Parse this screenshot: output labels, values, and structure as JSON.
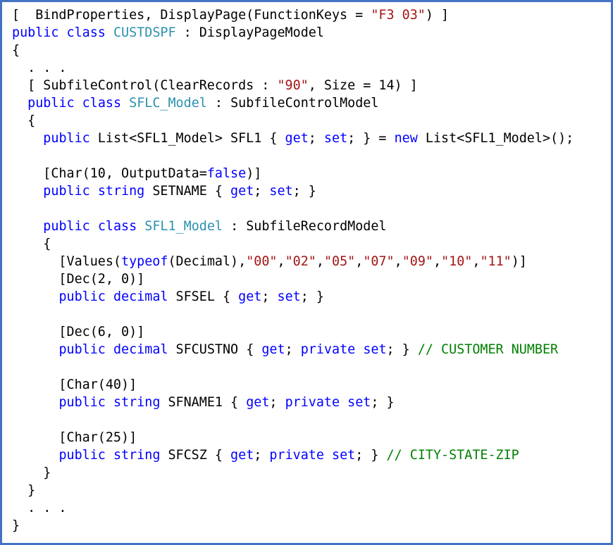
{
  "document": {
    "kind": "code-listing",
    "language": "C#",
    "colors": {
      "keyword": "#0000FF",
      "type_name": "#2B91AF",
      "string": "#A31515",
      "comment": "#008000",
      "plain": "#000000",
      "border": "#4472C4"
    },
    "lines": [
      [
        {
          "t": "pl",
          "v": "[  BindProperties, DisplayPage(FunctionKeys = "
        },
        {
          "t": "str",
          "v": "\"F3 03\""
        },
        {
          "t": "pl",
          "v": ") ]"
        }
      ],
      [
        {
          "t": "kw",
          "v": "public"
        },
        {
          "t": "pl",
          "v": " "
        },
        {
          "t": "kw",
          "v": "class"
        },
        {
          "t": "pl",
          "v": " "
        },
        {
          "t": "ty",
          "v": "CUSTDSPF"
        },
        {
          "t": "pl",
          "v": " : DisplayPageModel"
        }
      ],
      [
        {
          "t": "pl",
          "v": "{"
        }
      ],
      [
        {
          "t": "pl",
          "v": "  . . ."
        }
      ],
      [
        {
          "t": "pl",
          "v": "  [ SubfileControl(ClearRecords : "
        },
        {
          "t": "str",
          "v": "\"90\""
        },
        {
          "t": "pl",
          "v": ", Size = 14) ]"
        }
      ],
      [
        {
          "t": "pl",
          "v": "  "
        },
        {
          "t": "kw",
          "v": "public"
        },
        {
          "t": "pl",
          "v": " "
        },
        {
          "t": "kw",
          "v": "class"
        },
        {
          "t": "pl",
          "v": " "
        },
        {
          "t": "ty",
          "v": "SFLC_Model"
        },
        {
          "t": "pl",
          "v": " : SubfileControlModel"
        }
      ],
      [
        {
          "t": "pl",
          "v": "  {"
        }
      ],
      [
        {
          "t": "pl",
          "v": "    "
        },
        {
          "t": "kw",
          "v": "public"
        },
        {
          "t": "pl",
          "v": " List<SFL1_Model> SFL1 { "
        },
        {
          "t": "kw",
          "v": "get"
        },
        {
          "t": "pl",
          "v": "; "
        },
        {
          "t": "kw",
          "v": "set"
        },
        {
          "t": "pl",
          "v": "; } = "
        },
        {
          "t": "kw",
          "v": "new"
        },
        {
          "t": "pl",
          "v": " List<SFL1_Model>();"
        }
      ],
      [
        {
          "t": "pl",
          "v": ""
        }
      ],
      [
        {
          "t": "pl",
          "v": "    [Char(10, OutputData="
        },
        {
          "t": "kw",
          "v": "false"
        },
        {
          "t": "pl",
          "v": ")]"
        }
      ],
      [
        {
          "t": "pl",
          "v": "    "
        },
        {
          "t": "kw",
          "v": "public"
        },
        {
          "t": "pl",
          "v": " "
        },
        {
          "t": "kw",
          "v": "string"
        },
        {
          "t": "pl",
          "v": " SETNAME { "
        },
        {
          "t": "kw",
          "v": "get"
        },
        {
          "t": "pl",
          "v": "; "
        },
        {
          "t": "kw",
          "v": "set"
        },
        {
          "t": "pl",
          "v": "; }"
        }
      ],
      [
        {
          "t": "pl",
          "v": ""
        }
      ],
      [
        {
          "t": "pl",
          "v": "    "
        },
        {
          "t": "kw",
          "v": "public"
        },
        {
          "t": "pl",
          "v": " "
        },
        {
          "t": "kw",
          "v": "class"
        },
        {
          "t": "pl",
          "v": " "
        },
        {
          "t": "ty",
          "v": "SFL1_Model"
        },
        {
          "t": "pl",
          "v": " : SubfileRecordModel"
        }
      ],
      [
        {
          "t": "pl",
          "v": "    {"
        }
      ],
      [
        {
          "t": "pl",
          "v": "      [Values("
        },
        {
          "t": "kw",
          "v": "typeof"
        },
        {
          "t": "pl",
          "v": "(Decimal),"
        },
        {
          "t": "str",
          "v": "\"00\""
        },
        {
          "t": "pl",
          "v": ","
        },
        {
          "t": "str",
          "v": "\"02\""
        },
        {
          "t": "pl",
          "v": ","
        },
        {
          "t": "str",
          "v": "\"05\""
        },
        {
          "t": "pl",
          "v": ","
        },
        {
          "t": "str",
          "v": "\"07\""
        },
        {
          "t": "pl",
          "v": ","
        },
        {
          "t": "str",
          "v": "\"09\""
        },
        {
          "t": "pl",
          "v": ","
        },
        {
          "t": "str",
          "v": "\"10\""
        },
        {
          "t": "pl",
          "v": ","
        },
        {
          "t": "str",
          "v": "\"11\""
        },
        {
          "t": "pl",
          "v": ")]"
        }
      ],
      [
        {
          "t": "pl",
          "v": "      [Dec(2, 0)]"
        }
      ],
      [
        {
          "t": "pl",
          "v": "      "
        },
        {
          "t": "kw",
          "v": "public"
        },
        {
          "t": "pl",
          "v": " "
        },
        {
          "t": "kw",
          "v": "decimal"
        },
        {
          "t": "pl",
          "v": " SFSEL { "
        },
        {
          "t": "kw",
          "v": "get"
        },
        {
          "t": "pl",
          "v": "; "
        },
        {
          "t": "kw",
          "v": "set"
        },
        {
          "t": "pl",
          "v": "; }"
        }
      ],
      [
        {
          "t": "pl",
          "v": ""
        }
      ],
      [
        {
          "t": "pl",
          "v": "      [Dec(6, 0)]"
        }
      ],
      [
        {
          "t": "pl",
          "v": "      "
        },
        {
          "t": "kw",
          "v": "public"
        },
        {
          "t": "pl",
          "v": " "
        },
        {
          "t": "kw",
          "v": "decimal"
        },
        {
          "t": "pl",
          "v": " SFCUSTNO { "
        },
        {
          "t": "kw",
          "v": "get"
        },
        {
          "t": "pl",
          "v": "; "
        },
        {
          "t": "kw",
          "v": "private"
        },
        {
          "t": "pl",
          "v": " "
        },
        {
          "t": "kw",
          "v": "set"
        },
        {
          "t": "pl",
          "v": "; } "
        },
        {
          "t": "cm",
          "v": "// CUSTOMER NUMBER"
        }
      ],
      [
        {
          "t": "pl",
          "v": ""
        }
      ],
      [
        {
          "t": "pl",
          "v": "      [Char(40)]"
        }
      ],
      [
        {
          "t": "pl",
          "v": "      "
        },
        {
          "t": "kw",
          "v": "public"
        },
        {
          "t": "pl",
          "v": " "
        },
        {
          "t": "kw",
          "v": "string"
        },
        {
          "t": "pl",
          "v": " SFNAME1 { "
        },
        {
          "t": "kw",
          "v": "get"
        },
        {
          "t": "pl",
          "v": "; "
        },
        {
          "t": "kw",
          "v": "private"
        },
        {
          "t": "pl",
          "v": " "
        },
        {
          "t": "kw",
          "v": "set"
        },
        {
          "t": "pl",
          "v": "; }"
        }
      ],
      [
        {
          "t": "pl",
          "v": ""
        }
      ],
      [
        {
          "t": "pl",
          "v": "      [Char(25)]"
        }
      ],
      [
        {
          "t": "pl",
          "v": "      "
        },
        {
          "t": "kw",
          "v": "public"
        },
        {
          "t": "pl",
          "v": " "
        },
        {
          "t": "kw",
          "v": "string"
        },
        {
          "t": "pl",
          "v": " SFCSZ { "
        },
        {
          "t": "kw",
          "v": "get"
        },
        {
          "t": "pl",
          "v": "; "
        },
        {
          "t": "kw",
          "v": "private"
        },
        {
          "t": "pl",
          "v": " "
        },
        {
          "t": "kw",
          "v": "set"
        },
        {
          "t": "pl",
          "v": "; } "
        },
        {
          "t": "cm",
          "v": "// CITY-STATE-ZIP"
        }
      ],
      [
        {
          "t": "pl",
          "v": "    }"
        }
      ],
      [
        {
          "t": "pl",
          "v": "  }"
        }
      ],
      [
        {
          "t": "pl",
          "v": "  . . ."
        }
      ],
      [
        {
          "t": "pl",
          "v": "}"
        }
      ]
    ]
  }
}
